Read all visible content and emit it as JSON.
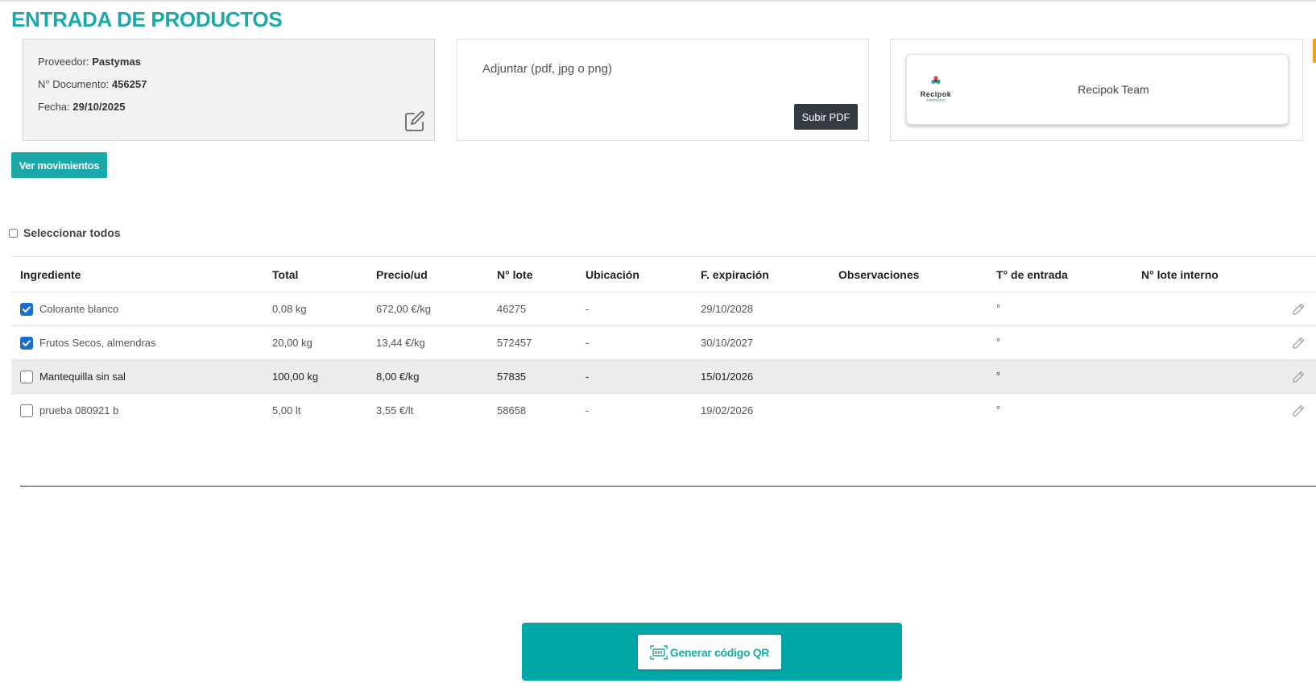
{
  "page": {
    "title": "ENTRADA DE PRODUCTOS"
  },
  "document": {
    "supplier_label": "Proveedor:",
    "supplier_value": "Pastymas",
    "doc_label": "N° Documento:",
    "doc_value": "456257",
    "date_label": "Fecha:",
    "date_value": "29/10/2025"
  },
  "attachment": {
    "label": "Adjuntar (pdf, jpg o png)",
    "upload_button": "Subir PDF"
  },
  "team": {
    "logo_text": "Recipok",
    "logo_subtext": "Formación",
    "name": "Recipok Team"
  },
  "actions": {
    "movements_button": "Ver movimientos",
    "select_all_label": "Seleccionar todos",
    "qr_button": "Generar código QR"
  },
  "table": {
    "headers": {
      "ingredient": "Ingrediente",
      "total": "Total",
      "price": "Precio/ud",
      "lot": "N° lote",
      "location": "Ubicación",
      "expiration": "F. expiración",
      "observations": "Observaciones",
      "temperature": "T° de entrada",
      "internal_lot": "N° lote interno"
    },
    "rows": [
      {
        "checked": true,
        "ingredient": "Colorante blanco",
        "total": "0,08 kg",
        "price": "672,00 €/kg",
        "lot": "46275",
        "location": "-",
        "expiration": "29/10/2028",
        "observations": "",
        "temperature": "°",
        "internal_lot": ""
      },
      {
        "checked": true,
        "ingredient": "Frutos Secos, almendras",
        "total": "20,00 kg",
        "price": "13,44 €/kg",
        "lot": "572457",
        "location": "-",
        "expiration": "30/10/2027",
        "observations": "",
        "temperature": "°",
        "internal_lot": ""
      },
      {
        "checked": false,
        "ingredient": "Mantequilla sin sal",
        "total": "100,00 kg",
        "price": "8,00 €/kg",
        "lot": "57835",
        "location": "-",
        "expiration": "15/01/2026",
        "observations": "",
        "temperature": "°",
        "internal_lot": ""
      },
      {
        "checked": false,
        "ingredient": "prueba 080921 b",
        "total": "5,00 lt",
        "price": "3,55 €/lt",
        "lot": "58658",
        "location": "-",
        "expiration": "19/02/2026",
        "observations": "",
        "temperature": "°",
        "internal_lot": ""
      }
    ]
  },
  "colors": {
    "brand": "#1aa8a8",
    "qr_bar": "#00a7a7",
    "dark_button": "#333a40",
    "checkbox_on": "#1a6fd4"
  },
  "icons": {
    "edit": "edit-square-icon",
    "row_edit": "pencil-icon",
    "qr": "barcode-scan-icon"
  }
}
